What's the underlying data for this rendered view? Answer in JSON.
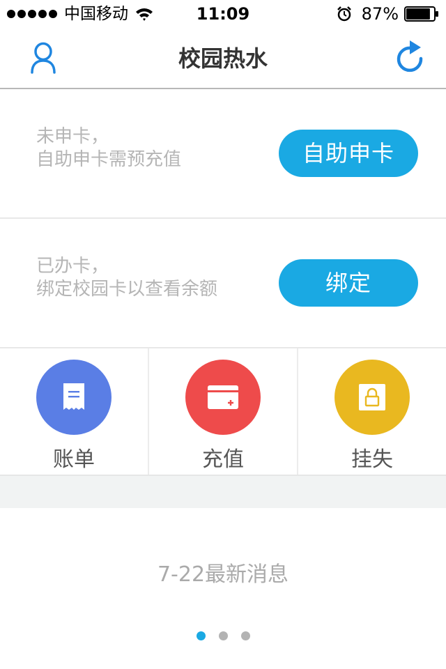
{
  "status_bar": {
    "carrier": "中国移动",
    "time": "11:09",
    "battery_percent": "87%",
    "battery_level": 0.87,
    "icons": [
      "signal-dots-icon",
      "wifi-icon",
      "alarm-icon",
      "battery-icon"
    ]
  },
  "nav": {
    "title": "校园热水",
    "left_icon": "user-icon",
    "right_icon": "refresh-icon"
  },
  "apply_card": {
    "line1": "未申卡，",
    "line2": "自助申卡需预充值",
    "button_label": "自助申卡"
  },
  "bind_card": {
    "line1": "已办卡，",
    "line2": "绑定校园卡以查看余额",
    "button_label": "绑定"
  },
  "actions": [
    {
      "label": "账单",
      "icon": "receipt-icon",
      "color": "#5a7ee5"
    },
    {
      "label": "充值",
      "icon": "wallet-add-icon",
      "color": "#ee4b4b"
    },
    {
      "label": "挂失",
      "icon": "lock-icon",
      "color": "#e9b820"
    }
  ],
  "news": {
    "title": "7-22最新消息",
    "page_count": 3,
    "active_page": 1
  },
  "colors": {
    "accent": "#1aa9e3",
    "text_muted": "#b5b5b5"
  }
}
